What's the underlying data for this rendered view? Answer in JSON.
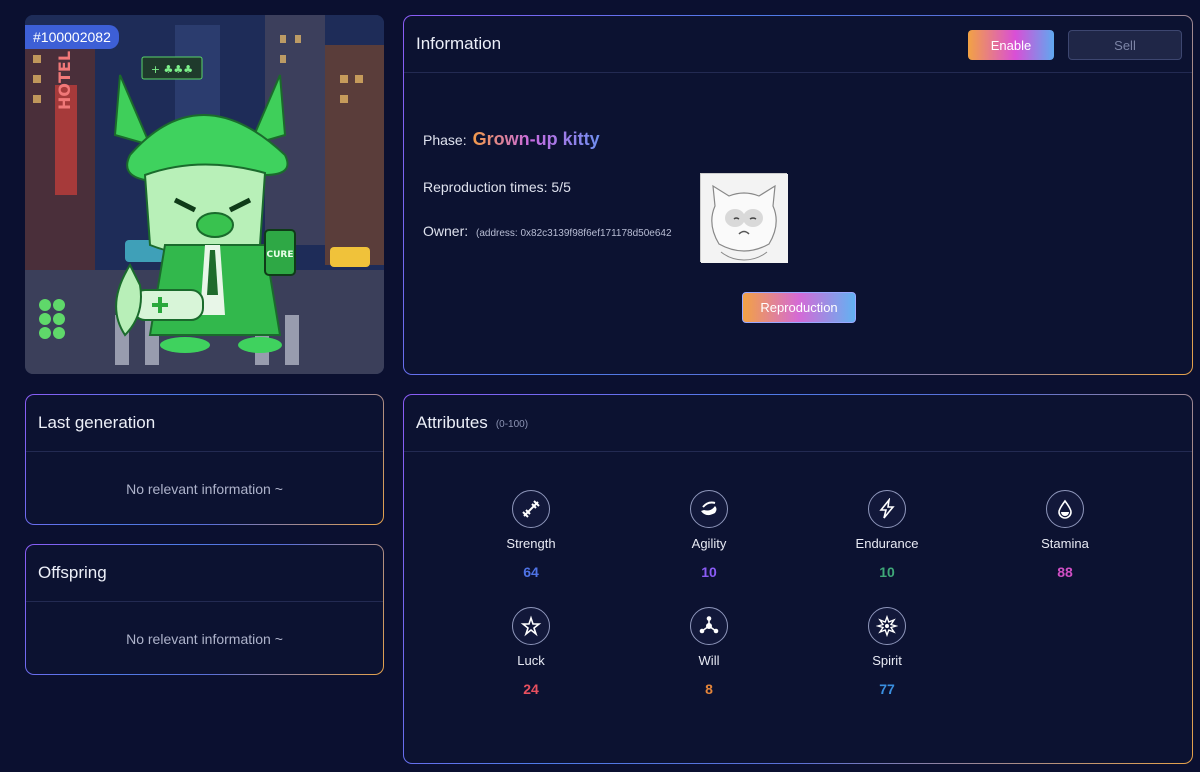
{
  "token": {
    "id": "#100002082"
  },
  "avatar": {
    "alt": "green hooded kitty character",
    "sign_text": "HOTEL",
    "badge_text": "+ ♣♣♣",
    "cure_text": "CURE"
  },
  "info": {
    "title": "Information",
    "enable_label": "Enable",
    "sell_label": "Sell",
    "phase_label": "Phase:",
    "phase_value": "Grown-up kitty",
    "repro_text": "Reproduction times: 5/5",
    "owner_label": "Owner:",
    "owner_address": "(address: 0x82c3139f98f6ef171178d50e642",
    "reproduction_label": "Reproduction"
  },
  "last_generation": {
    "title": "Last generation",
    "empty": "No relevant information ~"
  },
  "offspring": {
    "title": "Offspring",
    "empty": "No relevant information ~"
  },
  "attributes": {
    "title": "Attributes",
    "range": "(0-100)",
    "items": [
      {
        "name": "Strength",
        "value": "64",
        "color": "#4f73e6",
        "icon": "dumbbell-icon"
      },
      {
        "name": "Agility",
        "value": "10",
        "color": "#8b5cf6",
        "icon": "swirl-icon"
      },
      {
        "name": "Endurance",
        "value": "10",
        "color": "#3fa878",
        "icon": "lightning-icon"
      },
      {
        "name": "Stamina",
        "value": "88",
        "color": "#d04fc4",
        "icon": "drop-icon"
      },
      {
        "name": "Luck",
        "value": "24",
        "color": "#e8505f",
        "icon": "star-icon"
      },
      {
        "name": "Will",
        "value": "8",
        "color": "#e5853a",
        "icon": "molecule-icon"
      },
      {
        "name": "Spirit",
        "value": "77",
        "color": "#3a8fe0",
        "icon": "burst-icon"
      }
    ]
  }
}
